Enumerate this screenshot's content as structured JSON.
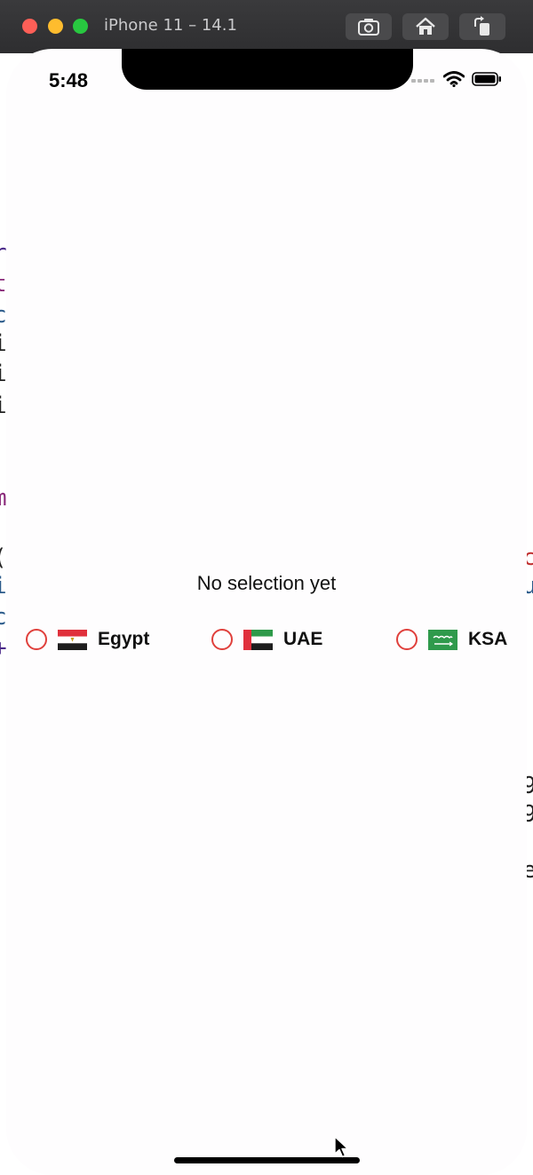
{
  "window": {
    "title": "iPhone 11 – 14.1"
  },
  "status_bar": {
    "time": "5:48"
  },
  "main": {
    "selection_text": "No selection yet",
    "options": [
      {
        "label": "Egypt",
        "flag": "egypt-flag-icon",
        "selected": false
      },
      {
        "label": "UAE",
        "flag": "uae-flag-icon",
        "selected": false
      },
      {
        "label": "KSA",
        "flag": "ksa-flag-icon",
        "selected": false
      }
    ]
  },
  "colors": {
    "radio_border": "#e0403c",
    "screen_background": "#fefdfe",
    "titlebar": "#2e2e30"
  },
  "icons": {
    "titlebar": [
      "screenshot-icon",
      "home-icon",
      "rotate-icon"
    ],
    "status": [
      "signal-icon",
      "wifi-icon",
      "battery-icon"
    ]
  }
}
